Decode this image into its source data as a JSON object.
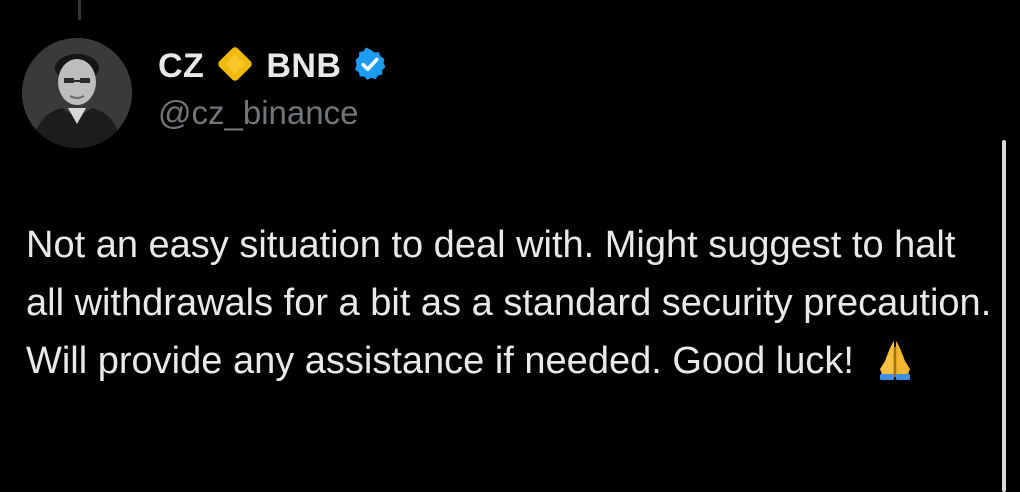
{
  "tweet": {
    "author": {
      "display_name_prefix": "CZ",
      "display_name_suffix": "BNB",
      "handle": "@cz_binance",
      "verified": true
    },
    "text": "Not an easy situation to deal with. Might suggest to halt all withdrawals for a bit as a standard security precaution. Will provide any assistance if needed. Good luck!",
    "trailing_emoji": "folded-hands-icon"
  },
  "colors": {
    "background": "#000000",
    "text_primary": "#e7e9ea",
    "text_secondary": "#71767b",
    "bnb_diamond": "#f0b90b",
    "verified_badge": "#1d9bf0"
  }
}
